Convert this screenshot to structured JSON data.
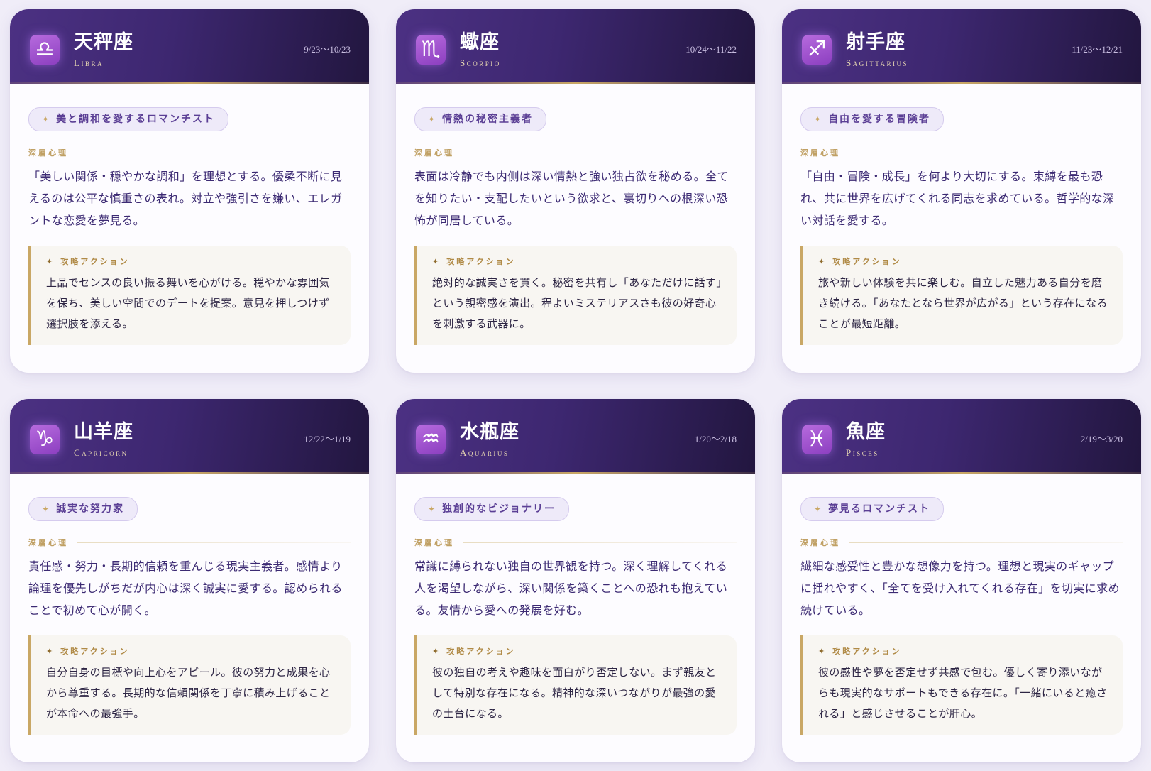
{
  "labels": {
    "psych": "深層心理",
    "action": "攻略アクション",
    "star": "✦"
  },
  "signs": [
    {
      "name": "天秤座",
      "english": "Libra",
      "dates": "9/23〜10/23",
      "symbol": "♎",
      "icon": "libra-icon",
      "tagline": "美と調和を愛するロマンチスト",
      "psychology": "「美しい関係・穏やかな調和」を理想とする。優柔不断に見えるのは公平な慎重さの表れ。対立や強引さを嫌い、エレガントな恋愛を夢見る。",
      "action": "上品でセンスの良い振る舞いを心がける。穏やかな雰囲気を保ち、美しい空間でのデートを提案。意見を押しつけず選択肢を添える。"
    },
    {
      "name": "蠍座",
      "english": "Scorpio",
      "dates": "10/24〜11/22",
      "symbol": "♏",
      "icon": "scorpio-icon",
      "tagline": "情熱の秘密主義者",
      "psychology": "表面は冷静でも内側は深い情熱と強い独占欲を秘める。全てを知りたい・支配したいという欲求と、裏切りへの根深い恐怖が同居している。",
      "action": "絶対的な誠実さを貫く。秘密を共有し「あなただけに話す」という親密感を演出。程よいミステリアスさも彼の好奇心を刺激する武器に。"
    },
    {
      "name": "射手座",
      "english": "Sagittarius",
      "dates": "11/23〜12/21",
      "symbol": "♐",
      "icon": "sagittarius-icon",
      "tagline": "自由を愛する冒険者",
      "psychology": "「自由・冒険・成長」を何より大切にする。束縛を最も恐れ、共に世界を広げてくれる同志を求めている。哲学的な深い対話を愛する。",
      "action": "旅や新しい体験を共に楽しむ。自立した魅力ある自分を磨き続ける。「あなたとなら世界が広がる」という存在になることが最短距離。"
    },
    {
      "name": "山羊座",
      "english": "Capricorn",
      "dates": "12/22〜1/19",
      "symbol": "♑",
      "icon": "capricorn-icon",
      "tagline": "誠実な努力家",
      "psychology": "責任感・努力・長期的信頼を重んじる現実主義者。感情より論理を優先しがちだが内心は深く誠実に愛する。認められることで初めて心が開く。",
      "action": "自分自身の目標や向上心をアピール。彼の努力と成果を心から尊重する。長期的な信頼関係を丁寧に積み上げることが本命への最強手。"
    },
    {
      "name": "水瓶座",
      "english": "Aquarius",
      "dates": "1/20〜2/18",
      "symbol": "♒",
      "icon": "aquarius-icon",
      "tagline": "独創的なビジョナリー",
      "psychology": "常識に縛られない独自の世界観を持つ。深く理解してくれる人を渇望しながら、深い関係を築くことへの恐れも抱えている。友情から愛への発展を好む。",
      "action": "彼の独自の考えや趣味を面白がり否定しない。まず親友として特別な存在になる。精神的な深いつながりが最強の愛の土台になる。"
    },
    {
      "name": "魚座",
      "english": "Pisces",
      "dates": "2/19〜3/20",
      "symbol": "♓",
      "icon": "pisces-icon",
      "tagline": "夢見るロマンチスト",
      "psychology": "繊細な感受性と豊かな想像力を持つ。理想と現実のギャップに揺れやすく、「全てを受け入れてくれる存在」を切実に求め続けている。",
      "action": "彼の感性や夢を否定せず共感で包む。優しく寄り添いながらも現実的なサポートもできる存在に。「一緒にいると癒される」と感じさせることが肝心。"
    }
  ]
}
